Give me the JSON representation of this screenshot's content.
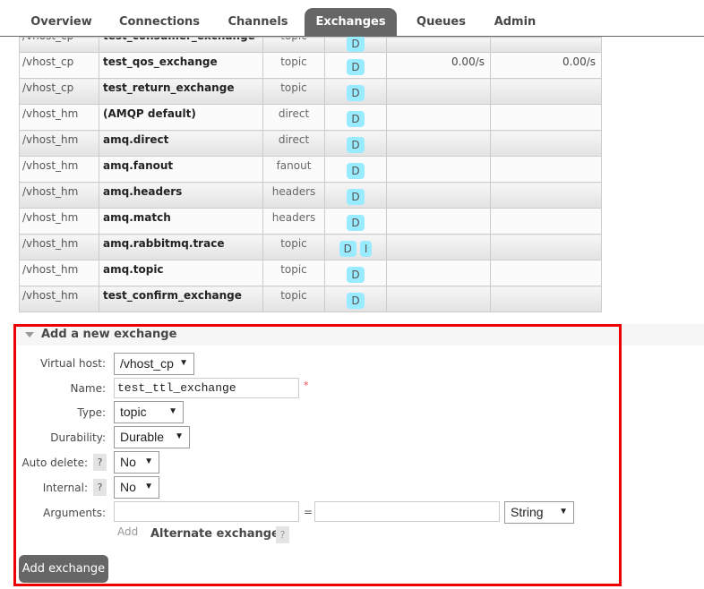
{
  "tabs": [
    {
      "label": "Overview",
      "active": false
    },
    {
      "label": "Connections",
      "active": false
    },
    {
      "label": "Channels",
      "active": false
    },
    {
      "label": "Exchanges",
      "active": true
    },
    {
      "label": "Queues",
      "active": false
    },
    {
      "label": "Admin",
      "active": false
    }
  ],
  "exchanges": [
    {
      "vhost": "/vhost_cp",
      "name": "test_consumer_exchange",
      "type": "topic",
      "features": [
        "D"
      ],
      "rate_in": "",
      "rate_out": ""
    },
    {
      "vhost": "/vhost_cp",
      "name": "test_qos_exchange",
      "type": "topic",
      "features": [
        "D"
      ],
      "rate_in": "0.00/s",
      "rate_out": "0.00/s"
    },
    {
      "vhost": "/vhost_cp",
      "name": "test_return_exchange",
      "type": "topic",
      "features": [
        "D"
      ],
      "rate_in": "",
      "rate_out": ""
    },
    {
      "vhost": "/vhost_hm",
      "name": "(AMQP default)",
      "type": "direct",
      "features": [
        "D"
      ],
      "rate_in": "",
      "rate_out": ""
    },
    {
      "vhost": "/vhost_hm",
      "name": "amq.direct",
      "type": "direct",
      "features": [
        "D"
      ],
      "rate_in": "",
      "rate_out": ""
    },
    {
      "vhost": "/vhost_hm",
      "name": "amq.fanout",
      "type": "fanout",
      "features": [
        "D"
      ],
      "rate_in": "",
      "rate_out": ""
    },
    {
      "vhost": "/vhost_hm",
      "name": "amq.headers",
      "type": "headers",
      "features": [
        "D"
      ],
      "rate_in": "",
      "rate_out": ""
    },
    {
      "vhost": "/vhost_hm",
      "name": "amq.match",
      "type": "headers",
      "features": [
        "D"
      ],
      "rate_in": "",
      "rate_out": ""
    },
    {
      "vhost": "/vhost_hm",
      "name": "amq.rabbitmq.trace",
      "type": "topic",
      "features": [
        "D",
        "I"
      ],
      "rate_in": "",
      "rate_out": ""
    },
    {
      "vhost": "/vhost_hm",
      "name": "amq.topic",
      "type": "topic",
      "features": [
        "D"
      ],
      "rate_in": "",
      "rate_out": ""
    },
    {
      "vhost": "/vhost_hm",
      "name": "test_confirm_exchange",
      "type": "topic",
      "features": [
        "D"
      ],
      "rate_in": "",
      "rate_out": ""
    }
  ],
  "add_exchange": {
    "section_title": "Add a new exchange",
    "virtual_host": {
      "label": "Virtual host:",
      "value": "/vhost_cp"
    },
    "name": {
      "label": "Name:",
      "value": "test_ttl_exchange",
      "required_mark": "*"
    },
    "type": {
      "label": "Type:",
      "value": "topic"
    },
    "durability": {
      "label": "Durability:",
      "value": "Durable"
    },
    "auto_delete": {
      "label": "Auto delete:",
      "value": "No",
      "help": "?"
    },
    "internal": {
      "label": "Internal:",
      "value": "No",
      "help": "?"
    },
    "arguments": {
      "label": "Arguments:",
      "key": "",
      "equals": "=",
      "value": "",
      "type": "String"
    },
    "add_link": "Add",
    "alternate_exchange": {
      "label": "Alternate exchange",
      "help": "?"
    },
    "submit_label": "Add exchange"
  },
  "colors": {
    "feature_badge": "#99ebff",
    "tab_active": "#666666",
    "highlight_border": "#ee0000"
  }
}
